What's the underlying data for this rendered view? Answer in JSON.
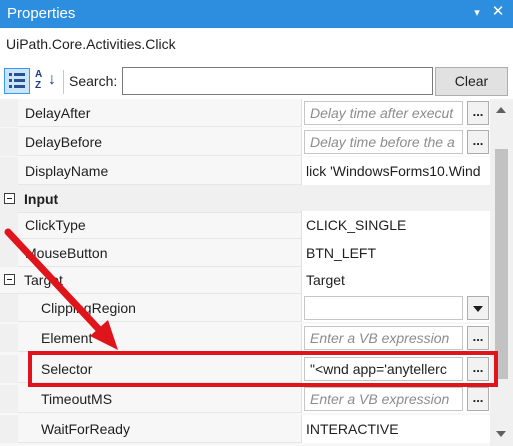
{
  "window": {
    "title": "Properties"
  },
  "object_name": "UiPath.Core.Activities.Click",
  "toolbar": {
    "search_label": "Search:",
    "search_value": "",
    "clear_label": "Clear"
  },
  "rows": [
    {
      "name": "DelayAfter",
      "placeholder": "Delay time after execut"
    },
    {
      "name": "DelayBefore",
      "placeholder": "Delay time before the a"
    },
    {
      "name": "DisplayName",
      "value": "lick 'WindowsForms10.Wind"
    },
    {
      "name": "Input"
    },
    {
      "name": "ClickType",
      "value": "CLICK_SINGLE"
    },
    {
      "name": "MouseButton",
      "value": "BTN_LEFT"
    },
    {
      "name": "Target",
      "value": "Target"
    },
    {
      "name": "ClippingRegion",
      "value": ""
    },
    {
      "name": "Element",
      "placeholder": "Enter a VB expression"
    },
    {
      "name": "Selector",
      "value": "\"<wnd app='anytellerc"
    },
    {
      "name": "TimeoutMS",
      "placeholder": "Enter a VB expression"
    },
    {
      "name": "WaitForReady",
      "value": "INTERACTIVE"
    }
  ],
  "ellipsis_label": "...",
  "colors": {
    "title_bar": "#2d8ee0",
    "highlight": "#e0141b",
    "placeholder": "#8c8c8c"
  }
}
